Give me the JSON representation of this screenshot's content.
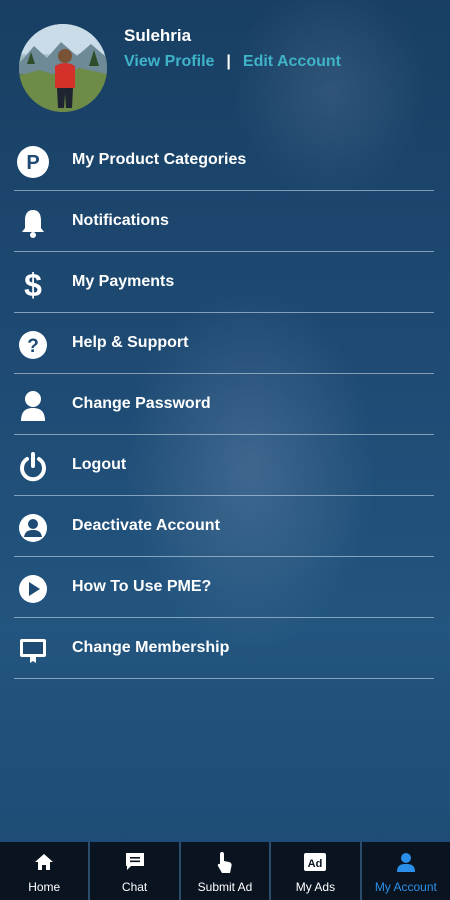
{
  "profile": {
    "name": "Sulehria",
    "view_profile": "View Profile",
    "separator": "|",
    "edit_account": "Edit Account"
  },
  "menu": {
    "items": [
      {
        "label": "My Product Categories",
        "icon": "p-circle-icon"
      },
      {
        "label": "Notifications",
        "icon": "bell-icon"
      },
      {
        "label": "My Payments",
        "icon": "dollar-icon"
      },
      {
        "label": "Help & Support",
        "icon": "question-circle-icon"
      },
      {
        "label": "Change Password",
        "icon": "user-icon"
      },
      {
        "label": "Logout",
        "icon": "power-icon"
      },
      {
        "label": "Deactivate Account",
        "icon": "user-circle-icon"
      },
      {
        "label": "How To Use PME?",
        "icon": "play-circle-icon"
      },
      {
        "label": "Change Membership",
        "icon": "membership-icon"
      }
    ]
  },
  "tabbar": {
    "tabs": [
      {
        "label": "Home",
        "icon": "home-icon"
      },
      {
        "label": "Chat",
        "icon": "chat-icon"
      },
      {
        "label": "Submit Ad",
        "icon": "tap-icon"
      },
      {
        "label": "My Ads",
        "icon": "ad-icon"
      },
      {
        "label": "My Account",
        "icon": "account-icon",
        "active": true
      }
    ]
  },
  "colors": {
    "link": "#3fb4c9",
    "active_tab": "#2a8fe8",
    "tabbar_bg": "#0a1420"
  }
}
